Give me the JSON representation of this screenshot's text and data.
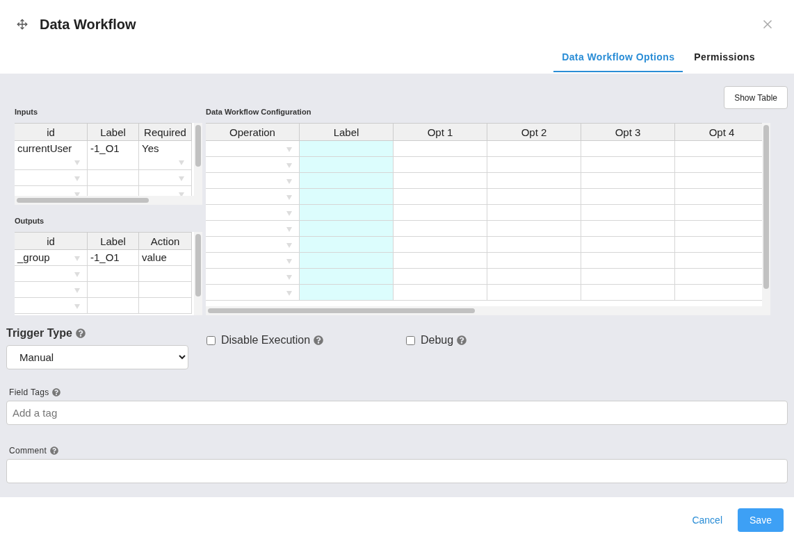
{
  "window": {
    "title": "Data Workflow"
  },
  "tabs": [
    {
      "label": "Data Workflow Options",
      "selected": true
    },
    {
      "label": "Permissions",
      "selected": false
    }
  ],
  "show_table_button": "Show Table",
  "inputs": {
    "title": "Inputs",
    "columns": [
      {
        "label": "id",
        "kind": "dropdown"
      },
      {
        "label": "Label",
        "kind": "text"
      },
      {
        "label": "Required",
        "kind": "dropdown"
      }
    ],
    "rows": [
      {
        "cells": [
          "currentUser",
          "-1_O1",
          "Yes"
        ]
      }
    ]
  },
  "outputs": {
    "title": "Outputs",
    "columns": [
      {
        "label": "id",
        "kind": "dropdown"
      },
      {
        "label": "Label",
        "kind": "text"
      },
      {
        "label": "Action",
        "kind": "text"
      }
    ],
    "rows": [
      {
        "cells": [
          "_group",
          "-1_O1",
          "value"
        ]
      }
    ]
  },
  "configuration": {
    "title": "Data Workflow Configuration",
    "columns": [
      {
        "label": "Operation",
        "kind": "dropdown",
        "highlighted": false
      },
      {
        "label": "Label",
        "kind": "text",
        "highlighted": true
      },
      {
        "label": "Opt 1",
        "kind": "text",
        "highlighted": false
      },
      {
        "label": "Opt 2",
        "kind": "text",
        "highlighted": false
      },
      {
        "label": "Opt 3",
        "kind": "text",
        "highlighted": false
      },
      {
        "label": "Opt 4",
        "kind": "text",
        "highlighted": false
      }
    ]
  },
  "trigger_type": {
    "label": "Trigger Type",
    "value": "Manual"
  },
  "options": [
    {
      "label": "Disable Execution",
      "checked": false
    },
    {
      "label": "Debug",
      "checked": false
    }
  ],
  "field_tags": {
    "label": "Field Tags",
    "placeholder": "Add a tag"
  },
  "comment": {
    "label": "Comment"
  },
  "footer": {
    "cancel": "Cancel",
    "save": "Save"
  }
}
